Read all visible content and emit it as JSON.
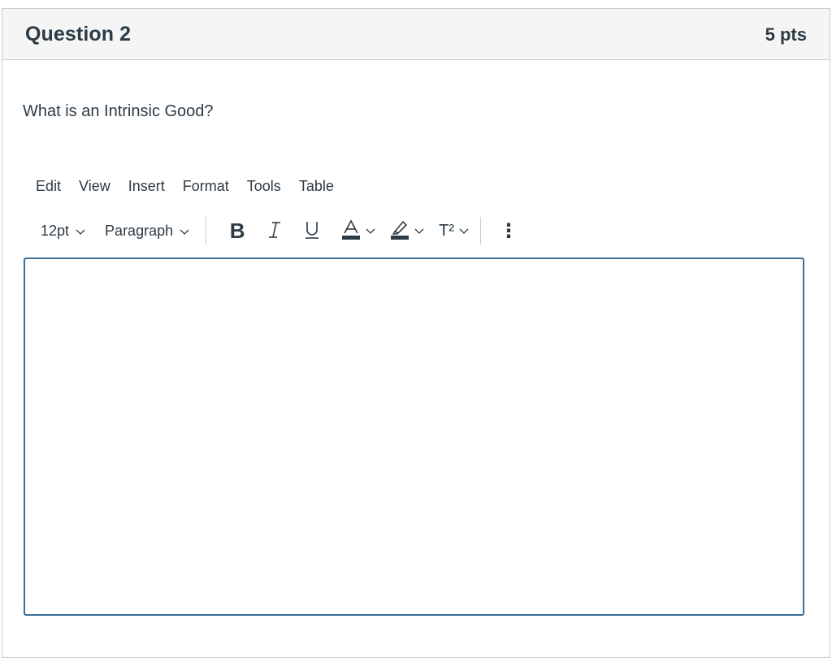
{
  "question": {
    "title": "Question 2",
    "points": "5 pts",
    "prompt": "What is an Intrinsic Good?"
  },
  "menubar": {
    "items": [
      "Edit",
      "View",
      "Insert",
      "Format",
      "Tools",
      "Table"
    ]
  },
  "toolbar": {
    "font_size": "12pt",
    "block_format": "Paragraph",
    "bold_label": "B",
    "italic_label": "I",
    "underline_label": "U",
    "text_color_label": "A",
    "superscript_label": "T²",
    "more_label": "⋮"
  },
  "colors": {
    "header_bg": "#f5f5f5",
    "text": "#2d3b45",
    "editor_border": "#3a6d95",
    "border": "#c7cdd1"
  },
  "editor": {
    "content": ""
  }
}
